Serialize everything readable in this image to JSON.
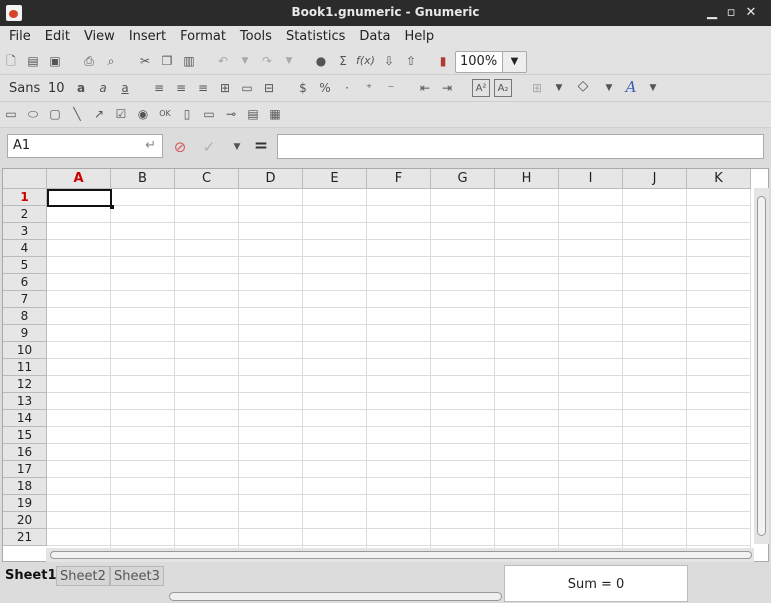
{
  "window": {
    "title": "Book1.gnumeric - Gnumeric"
  },
  "menu": [
    "File",
    "Edit",
    "View",
    "Insert",
    "Format",
    "Tools",
    "Statistics",
    "Data",
    "Help"
  ],
  "toolbar": {
    "zoom": "100%",
    "font_name": "Sans",
    "font_size": "10"
  },
  "entry": {
    "cell_ref": "A1",
    "formula": "",
    "equals": "="
  },
  "grid": {
    "columns": [
      "A",
      "B",
      "C",
      "D",
      "E",
      "F",
      "G",
      "H",
      "I",
      "J",
      "K"
    ],
    "rows": [
      "1",
      "2",
      "3",
      "4",
      "5",
      "6",
      "7",
      "8",
      "9",
      "10",
      "11",
      "12",
      "13",
      "14",
      "15",
      "16",
      "17",
      "18",
      "19",
      "20",
      "21"
    ],
    "selected_column": "A",
    "selected_row": "1"
  },
  "sheets": [
    {
      "name": "Sheet1",
      "active": true
    },
    {
      "name": "Sheet2",
      "active": false
    },
    {
      "name": "Sheet3",
      "active": false
    }
  ],
  "status": {
    "sum": "Sum = 0"
  },
  "colors": {
    "selection_header": "#cc0000",
    "titlebar": "#2b2b2b"
  }
}
